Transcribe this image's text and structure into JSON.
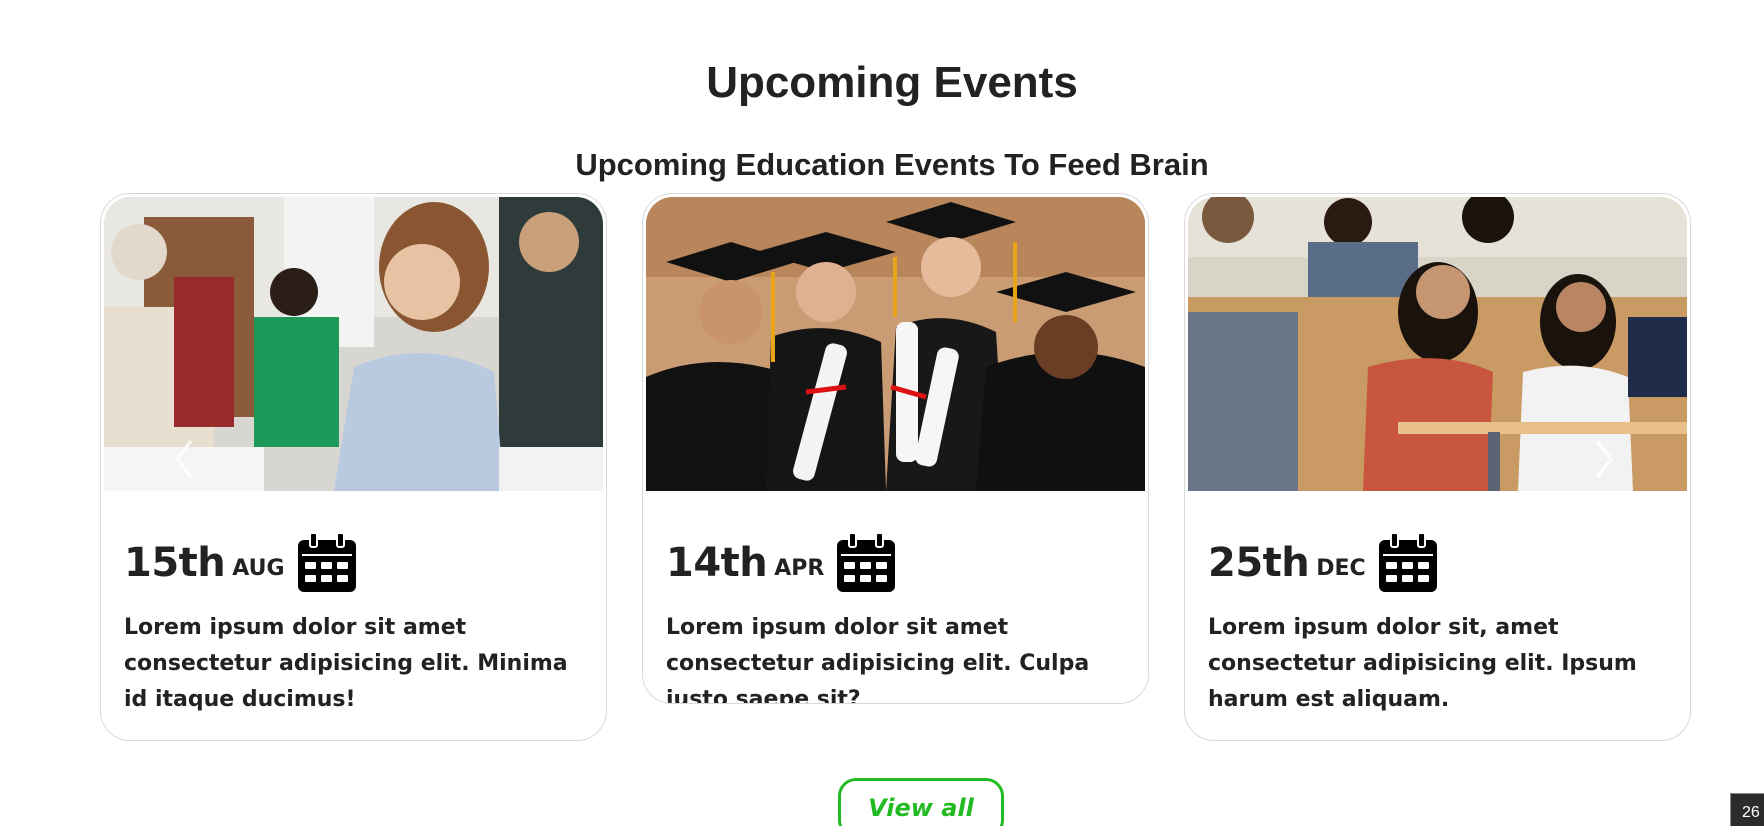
{
  "section": {
    "title": "Upcoming Events",
    "subtitle": "Upcoming Education Events To Feed Brain"
  },
  "events": [
    {
      "day": "15th",
      "month": "AUG",
      "description": "Lorem ipsum dolor sit amet consectetur adipisicing elit. Minima id itaque ducimus!",
      "image": "students-writing-exam-photo",
      "icon": "calendar-icon"
    },
    {
      "day": "14th",
      "month": "APR",
      "description": "Lorem ipsum dolor sit amet consectetur adipisicing elit. Culpa iusto saepe sit?",
      "image": "graduates-with-diplomas-photo",
      "icon": "calendar-icon"
    },
    {
      "day": "25th",
      "month": "DEC",
      "description": "Lorem ipsum dolor sit, amet consectetur adipisicing elit. Ipsum harum est aliquam.",
      "image": "students-in-lecture-hall-photo",
      "icon": "calendar-icon"
    }
  ],
  "carousel": {
    "prev_icon": "chevron-left-icon",
    "next_icon": "chevron-right-icon"
  },
  "view_all_label": "View all",
  "corner_badge": "26",
  "colors": {
    "accent_green": "#22bb22",
    "text_dark": "#222222",
    "card_border": "#d9d9d9"
  }
}
